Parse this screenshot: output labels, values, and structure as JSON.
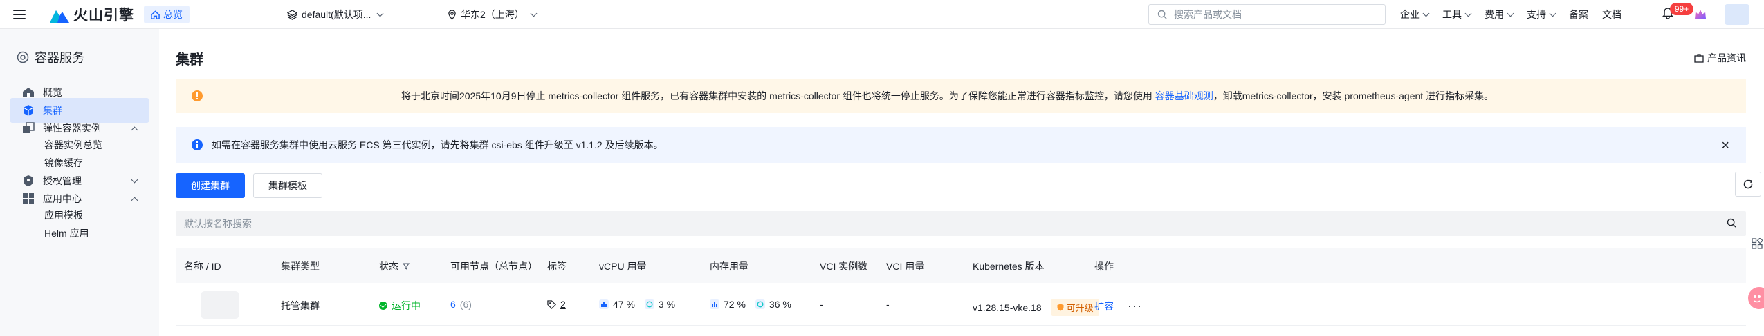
{
  "topbar": {
    "brand": "火山引擎",
    "home": "总览",
    "project": "default(默认项...",
    "region": "华东2（上海）",
    "search_placeholder": "搜索产品或文档",
    "menus": [
      "企业",
      "工具",
      "费用",
      "支持"
    ],
    "links": [
      "备案",
      "文档"
    ],
    "badge": "99+"
  },
  "sidebar": {
    "title": "容器服务",
    "items": [
      {
        "label": "概览"
      },
      {
        "label": "集群"
      },
      {
        "label": "弹性容器实例"
      },
      {
        "label": "容器实例总览"
      },
      {
        "label": "镜像缓存"
      },
      {
        "label": "授权管理"
      },
      {
        "label": "应用中心"
      },
      {
        "label": "应用模板"
      },
      {
        "label": "Helm 应用"
      }
    ]
  },
  "main": {
    "title": "集群",
    "product_info": "产品资讯",
    "warn": {
      "before": "将于北京时间2025年10月9日停止 metrics-collector 组件服务，已有容器集群中安装的 metrics-collector 组件也将统一停止服务。为了保障您能正常进行容器指标监控，请您使用",
      "link": "容器基础观测",
      "after": "，卸载metrics-collector，安装 prometheus-agent 进行指标采集。"
    },
    "info": "如需在容器服务集群中使用云服务 ECS 第三代实例，请先将集群 csi-ebs 组件升级至 v1.1.2 及后续版本。",
    "create_button": "创建集群",
    "template_button": "集群模板",
    "filter_placeholder": "默认按名称搜索",
    "table": {
      "headers": [
        "名称 / ID",
        "集群类型",
        "状态",
        "可用节点（总节点）",
        "标签",
        "vCPU 用量",
        "内存用量",
        "VCI 实例数",
        "VCI 用量",
        "Kubernetes 版本",
        "操作"
      ],
      "row": {
        "type": "托管集群",
        "status": "运行中",
        "nodes_available": "6",
        "nodes_total": "(6)",
        "tags": "2",
        "vcpu_a": "47 %",
        "vcpu_b": "3 %",
        "mem_a": "72 %",
        "mem_b": "36 %",
        "vci_count": "-",
        "vci_usage": "-",
        "k8s_version": "v1.28.15-vke.18",
        "upgrade": "可升级",
        "action": "扩容",
        "more": "···"
      }
    }
  },
  "colors": {
    "primary": "#1664ff",
    "success": "#00b42a",
    "warning_bg": "#fff7e8",
    "info_bg": "#f0f5ff"
  }
}
